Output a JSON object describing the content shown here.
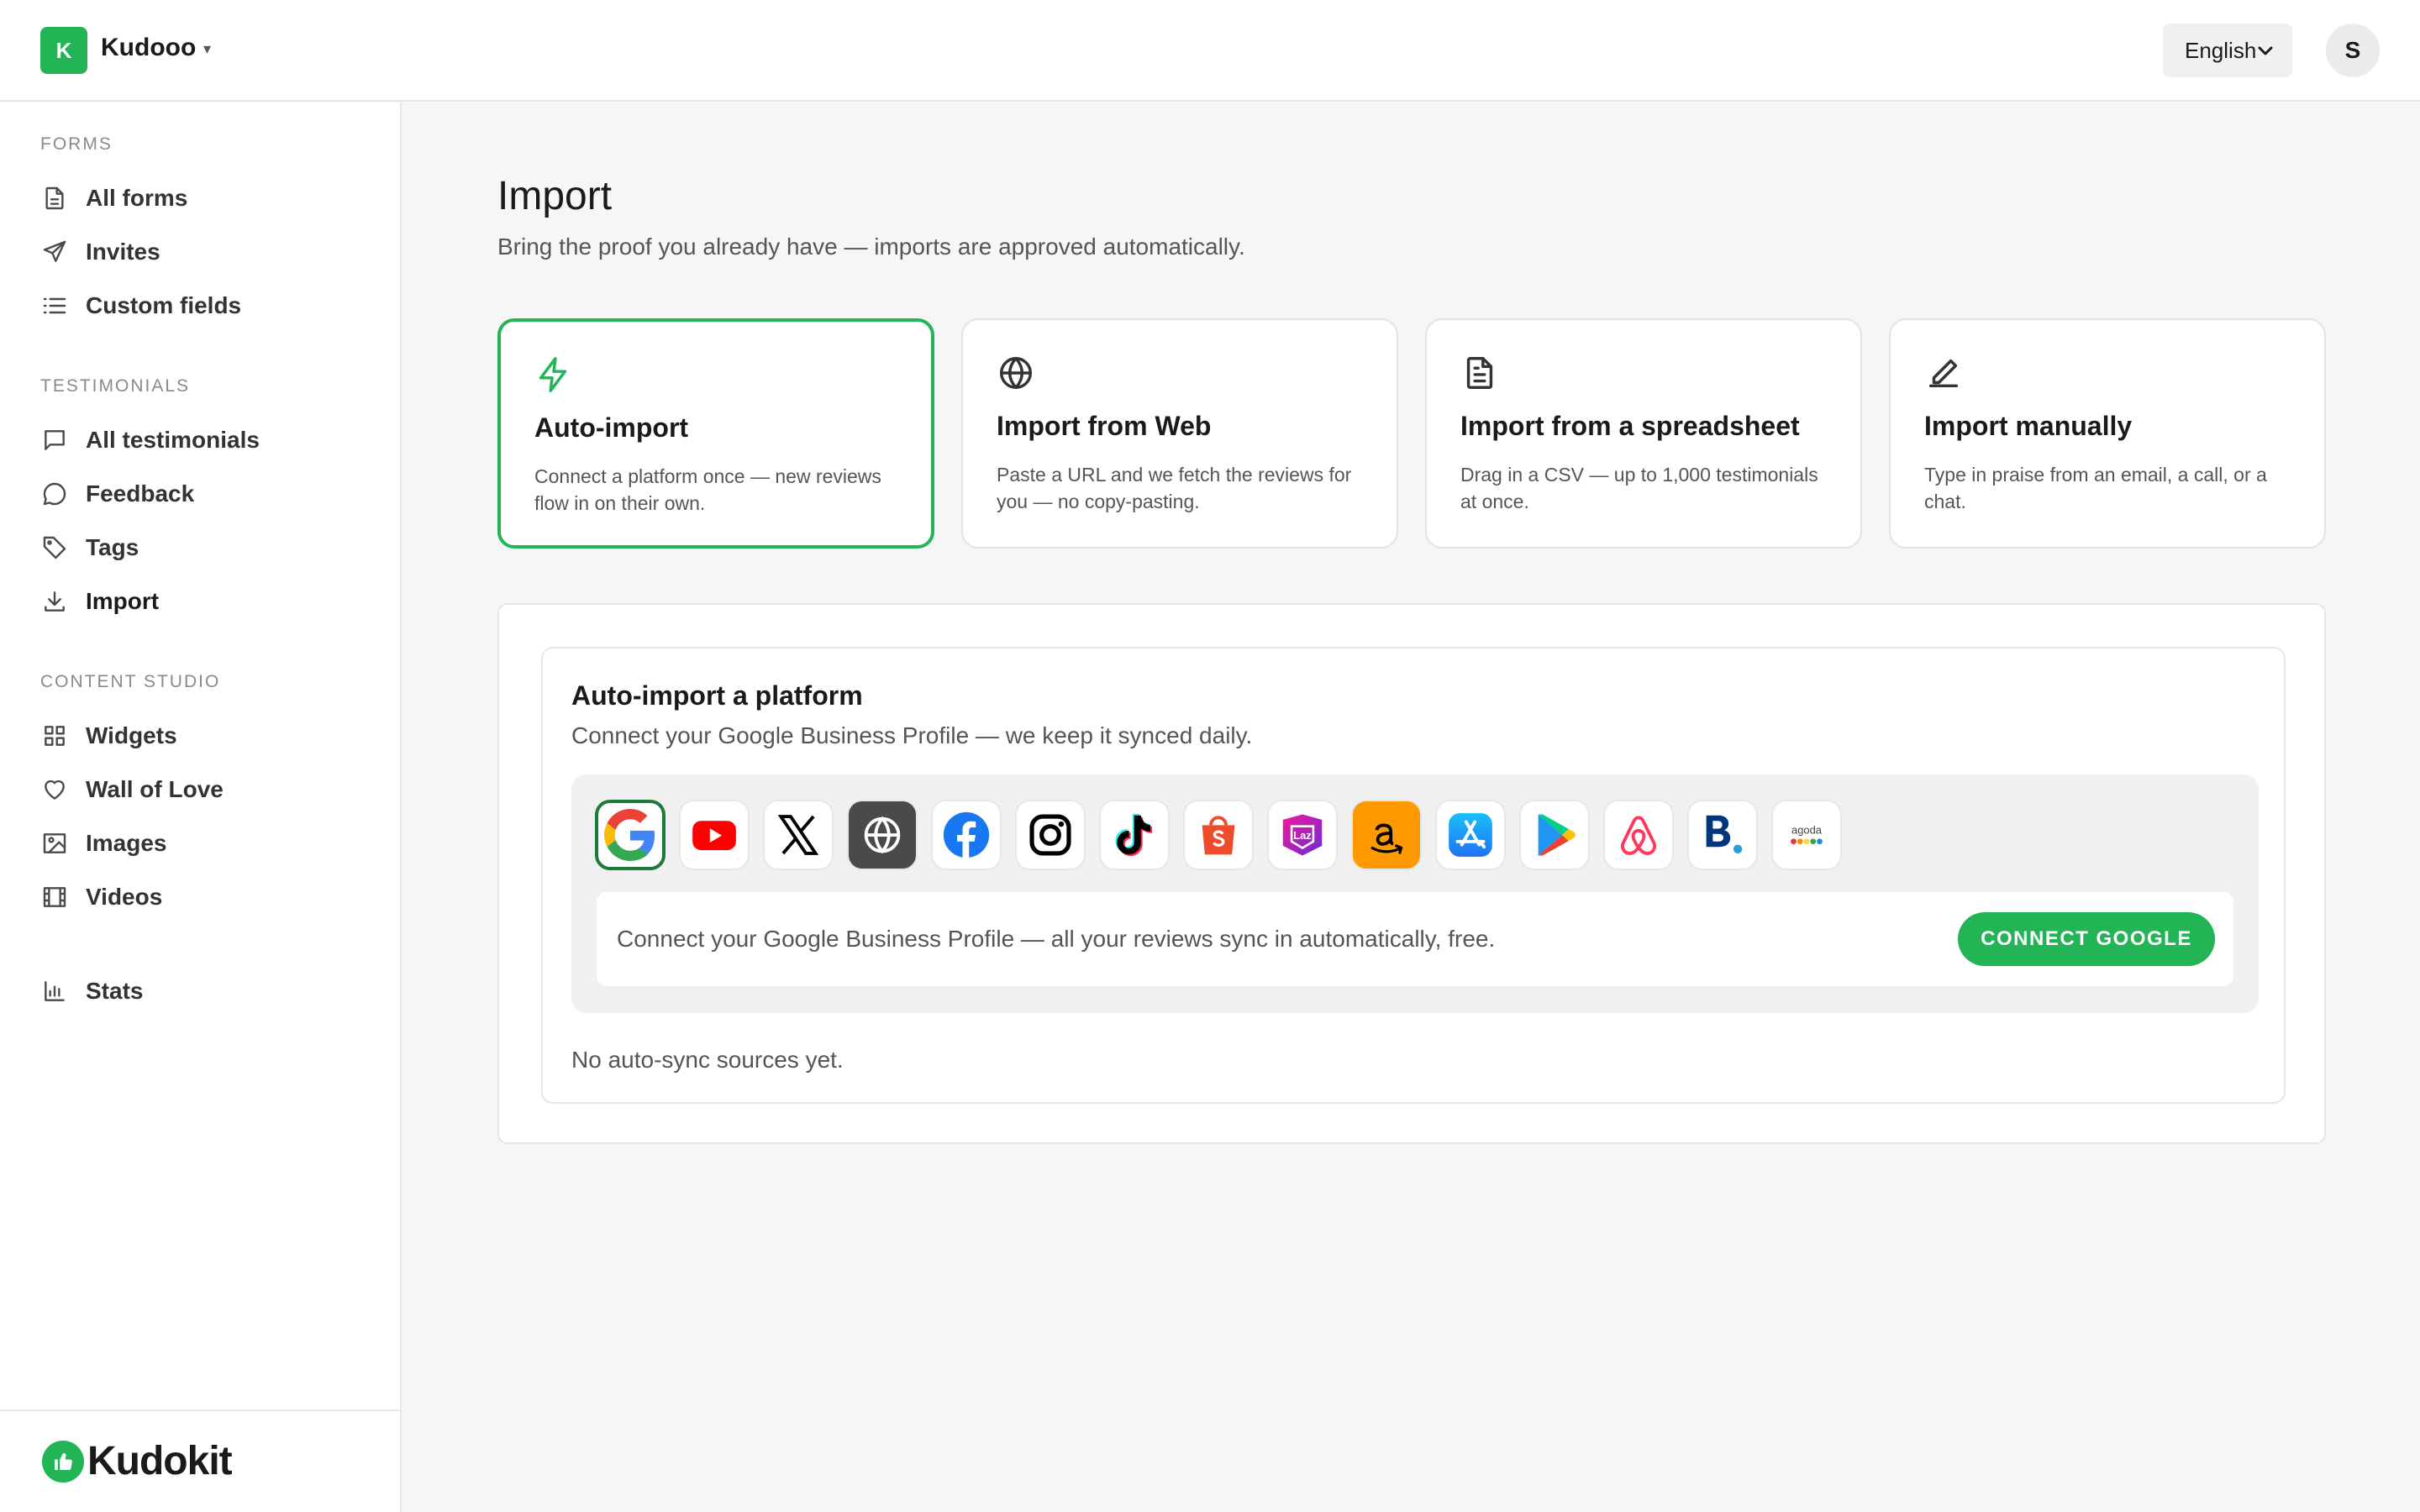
{
  "header": {
    "workspace_initial": "K",
    "workspace_name": "Kudooo",
    "workspace_caret": "▾",
    "language": "English",
    "user_initial": "S"
  },
  "sidebar": {
    "sections": [
      {
        "label": "FORMS",
        "items": [
          {
            "label": "All forms",
            "icon": "document-icon"
          },
          {
            "label": "Invites",
            "icon": "send-icon"
          },
          {
            "label": "Custom fields",
            "icon": "list-icon"
          }
        ]
      },
      {
        "label": "TESTIMONIALS",
        "items": [
          {
            "label": "All testimonials",
            "icon": "message-square-icon"
          },
          {
            "label": "Feedback",
            "icon": "chat-bubble-icon"
          },
          {
            "label": "Tags",
            "icon": "tag-icon"
          },
          {
            "label": "Import",
            "icon": "download-icon"
          }
        ]
      },
      {
        "label": "CONTENT STUDIO",
        "items": [
          {
            "label": "Widgets",
            "icon": "grid-icon"
          },
          {
            "label": "Wall of Love",
            "icon": "heart-icon"
          },
          {
            "label": "Images",
            "icon": "image-icon"
          },
          {
            "label": "Videos",
            "icon": "film-icon"
          }
        ]
      }
    ],
    "stats_label": "Stats",
    "brand_name": "Kudokit"
  },
  "main": {
    "title": "Import",
    "subtitle": "Bring the proof you already have — imports are approved automatically.",
    "cards": [
      {
        "title": "Auto-import",
        "desc": "Connect a platform once — new reviews flow in on their own.",
        "icon": "lightning-icon"
      },
      {
        "title": "Import from Web",
        "desc": "Paste a URL and we fetch the reviews for you — no copy-pasting.",
        "icon": "globe-icon"
      },
      {
        "title": "Import from a spreadsheet",
        "desc": "Drag in a CSV — up to 1,000 testimonials at once.",
        "icon": "file-text-icon"
      },
      {
        "title": "Import manually",
        "desc": "Type in praise from an email, a call, or a chat.",
        "icon": "pencil-icon"
      }
    ],
    "panel": {
      "title": "Auto-import a platform",
      "subtitle": "Connect your Google Business Profile — we keep it synced daily.",
      "platforms": [
        "google",
        "youtube",
        "x",
        "web",
        "facebook",
        "instagram",
        "tiktok",
        "shopee",
        "lazada",
        "amazon",
        "app-store",
        "google-play",
        "airbnb",
        "booking",
        "agoda"
      ],
      "agoda_label": "agoda",
      "lazada_label": "Laz",
      "connect_text": "Connect your Google Business Profile — all your reviews sync in automatically, free.",
      "connect_button": "CONNECT GOOGLE",
      "empty_note": "No auto-sync sources yet."
    }
  },
  "colors": {
    "accent": "#22b455",
    "selected_border": "#1e7a3c"
  }
}
